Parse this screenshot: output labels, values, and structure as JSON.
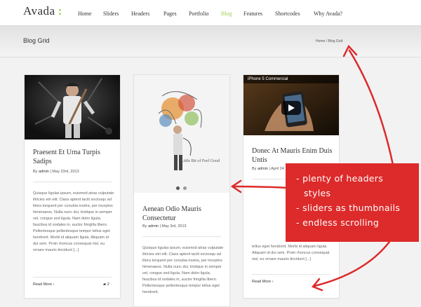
{
  "header": {
    "logo": "Avada",
    "logo_colon": ":",
    "nav": [
      "Home",
      "Sliders",
      "Headers",
      "Pages",
      "Portfolio",
      "Blog",
      "Features",
      "Shortcodes",
      "Why Avada?"
    ]
  },
  "titlebar": {
    "title": "Blog Grid",
    "breadcrumb": "Home / Blog Grid"
  },
  "posts": [
    {
      "title": "Praesent Et Urna Turpis Sadips",
      "by": "By",
      "author": "admin",
      "date": "| May 23rd, 2013",
      "excerpt": "Quisque ligulas ipsum, euismod atras vulputate iltricies etri elit. Class aptent taciti sociosqu ad litora torquent per conubia nostra, per inceptos himenaeos. Nulla nunc dui, tristique in semper vel, congue sed ligula. Nam dolor ligula, faucibus id sodales in, auctor fringilla libero. Pellentesque pellentesque tempor tellus eget hendrerit. Morbi id aliquam ligula. Aliquam id dui sem. Proin rhoncus consequat nisl, eu ornare mauris tincidunt [...]",
      "read_more": "Read More ›",
      "comments": "2"
    },
    {
      "title": "Aenean Odio Mauris Consectetur",
      "by": "By",
      "author": "admin",
      "date": "| May 3rd, 2013",
      "image_caption": "Little Bit of Feel Good",
      "excerpt": "Quisque ligulas ipsum, euismod atras vulputate iltricies etri elit. Class aptent taciti sociosqu ad litora torquent per conubia nostra, per inceptos himenaeos. Nulla nunc dui, tristique in semper vel, congue sed ligula. Nam dolor ligula, faucibus id sodales in, auctor fringilla libero. Pellentesque pellentesque tempor tellus eget hendrerit."
    },
    {
      "title": "Donec At Mauris Enim Duis Untis",
      "by": "By",
      "author": "admin",
      "date": "| April 24",
      "video_title": "iPhone 5 Commercial",
      "excerpt": "tellus eget hendrerit. Morbi id aliquam ligula. Aliquam id dui sem. Proin rhoncus consequat nisl, eu ornare mauris tincidunt [...]",
      "read_more": "Read More ›"
    }
  ],
  "callout": {
    "lines": [
      "- plenty of headers",
      "styles",
      "- sliders as thumbnails",
      "- endless scrolling"
    ],
    "color": "#dd2a2a"
  },
  "colors": {
    "accent": "#a0ce4e",
    "arrow": "#dd2a2a"
  }
}
